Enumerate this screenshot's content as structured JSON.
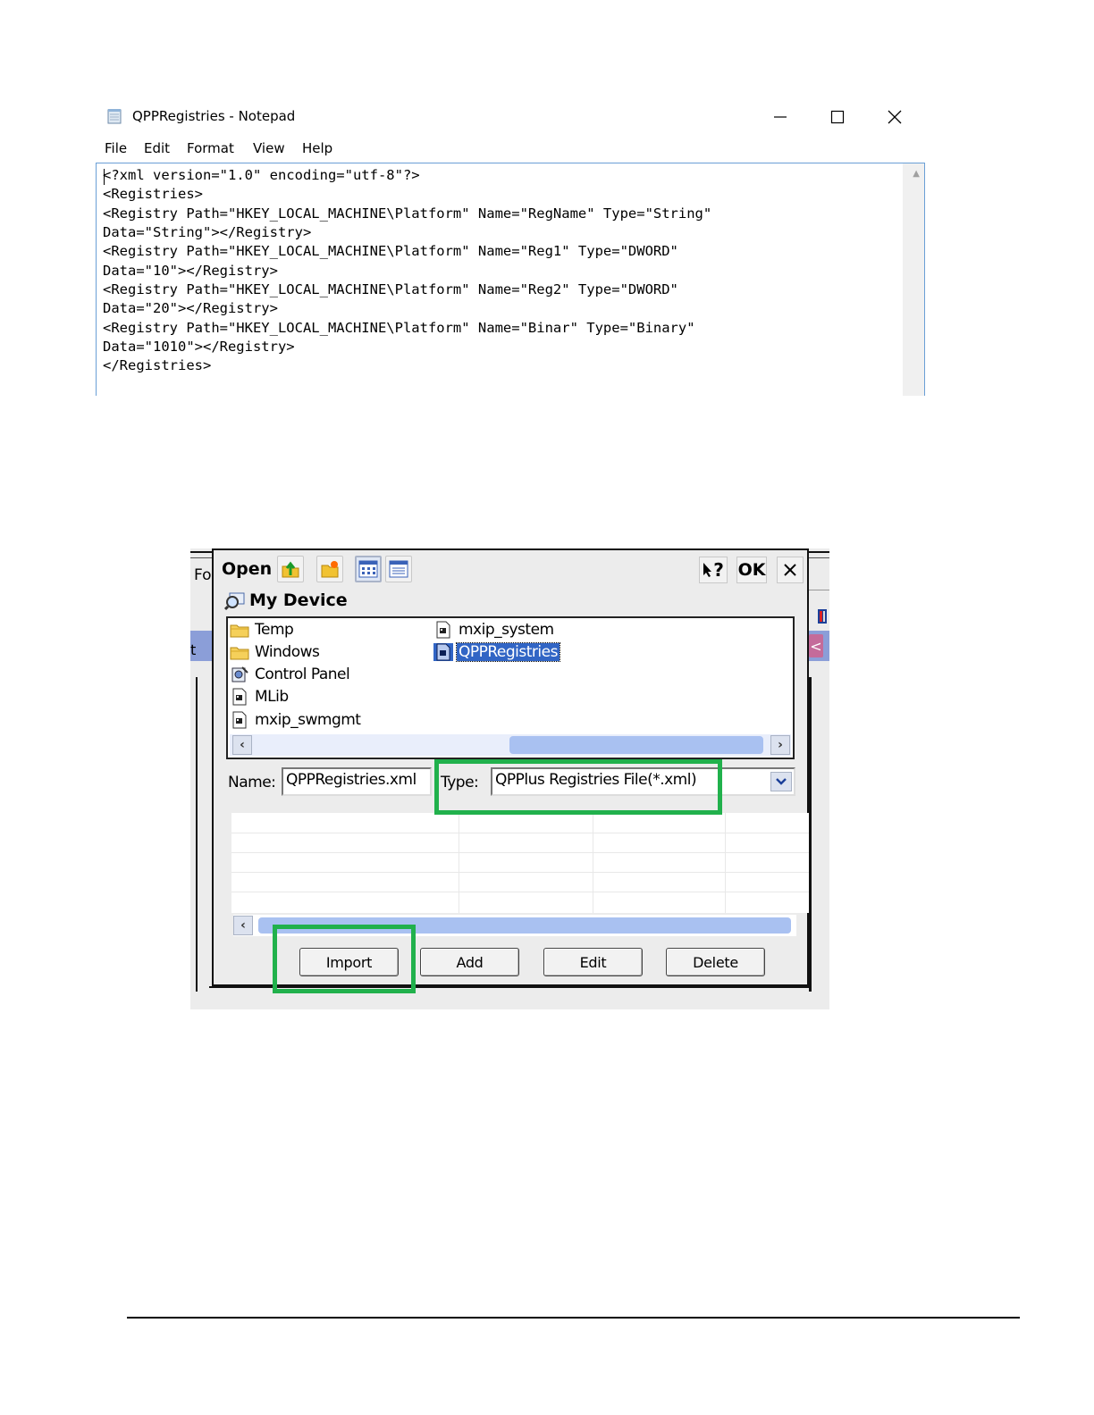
{
  "notepad": {
    "title": "QPPRegistries - Notepad",
    "menu": [
      "File",
      "Edit",
      "Format",
      "View",
      "Help"
    ],
    "content": "<?xml version=\"1.0\" encoding=\"utf-8\"?>\n<Registries>\n<Registry Path=\"HKEY_LOCAL_MACHINE\\Platform\" Name=\"RegName\" Type=\"String\"\nData=\"String\"></Registry>\n<Registry Path=\"HKEY_LOCAL_MACHINE\\Platform\" Name=\"Reg1\" Type=\"DWORD\"\nData=\"10\"></Registry>\n<Registry Path=\"HKEY_LOCAL_MACHINE\\Platform\" Name=\"Reg2\" Type=\"DWORD\"\nData=\"20\"></Registry>\n<Registry Path=\"HKEY_LOCAL_MACHINE\\Platform\" Name=\"Binar\" Type=\"Binary\"\nData=\"1010\"></Registry>\n</Registries>"
  },
  "dialog": {
    "title": "Open",
    "help_label": "?",
    "ok_label": "OK",
    "location": "My Device",
    "files": [
      {
        "name": "Temp",
        "icon": "folder-icon"
      },
      {
        "name": "Windows",
        "icon": "folder-icon"
      },
      {
        "name": "Control Panel",
        "icon": "control-panel-icon"
      },
      {
        "name": "MLib",
        "icon": "file-icon"
      },
      {
        "name": "mxip_swmgmt",
        "icon": "file-icon"
      },
      {
        "name": "mxip_system",
        "icon": "file-icon"
      },
      {
        "name": "QPPRegistries",
        "icon": "file-icon",
        "selected": true
      }
    ],
    "name_label": "Name:",
    "name_value": "QPPRegistries.xml",
    "type_label": "Type:",
    "type_value": "QPPlus Registries File(*.xml)"
  },
  "background_app": {
    "partial_label": "Fo",
    "partial_left": "t"
  },
  "actions": {
    "import": "Import",
    "add": "Add",
    "edit": "Edit",
    "delete": "Delete"
  },
  "colors": {
    "highlight": "#21b14c",
    "selection": "#3165c5",
    "scroll_thumb": "#a9c1f1"
  }
}
